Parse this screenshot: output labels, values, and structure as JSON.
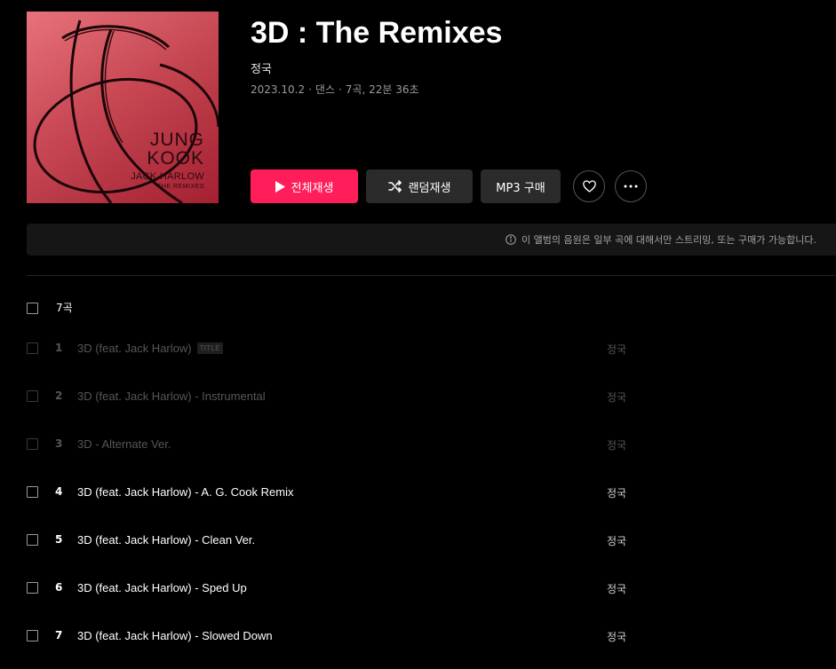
{
  "album": {
    "cover": {
      "artist_line1": "JUNG",
      "artist_line2": "KOOK",
      "feat": "JACK HARLOW",
      "subtitle": "THE REMIXES"
    },
    "title": "3D : The Remixes",
    "artist": "정국",
    "release_date": "2023.10.2",
    "genre": "댄스",
    "summary": "7곡, 22분 36초"
  },
  "actions": {
    "play_all_label": "전체재생",
    "shuffle_label": "랜덤재생",
    "mp3_label": "MP3 구매"
  },
  "notice": {
    "text": "이 앨범의 음원은 일부 곡에 대해서만 스트리밍, 또는 구매가 가능합니다."
  },
  "list": {
    "count_label": "7곡"
  },
  "tracks": [
    {
      "num": "1",
      "title": "3D (feat. Jack Harlow)",
      "badge": "TITLE",
      "artist": "정국",
      "available": false
    },
    {
      "num": "2",
      "title": "3D (feat. Jack Harlow) - Instrumental",
      "artist": "정국",
      "available": false
    },
    {
      "num": "3",
      "title": "3D - Alternate Ver.",
      "artist": "정국",
      "available": false
    },
    {
      "num": "4",
      "title": "3D (feat. Jack Harlow) - A. G. Cook Remix",
      "artist": "정국",
      "available": true
    },
    {
      "num": "5",
      "title": "3D (feat. Jack Harlow) - Clean Ver.",
      "artist": "정국",
      "available": true
    },
    {
      "num": "6",
      "title": "3D (feat. Jack Harlow) - Sped Up",
      "artist": "정국",
      "available": true
    },
    {
      "num": "7",
      "title": "3D (feat. Jack Harlow) - Slowed Down",
      "artist": "정국",
      "available": true
    }
  ],
  "colors": {
    "accent": "#ff1e5a",
    "background": "#000000",
    "button_dark": "#2b2b2b",
    "dim_text": "#565656"
  },
  "icons": {
    "play": "play-icon",
    "shuffle": "shuffle-icon",
    "like": "heart-icon",
    "more": "more-dots-icon",
    "info": "info-icon"
  }
}
